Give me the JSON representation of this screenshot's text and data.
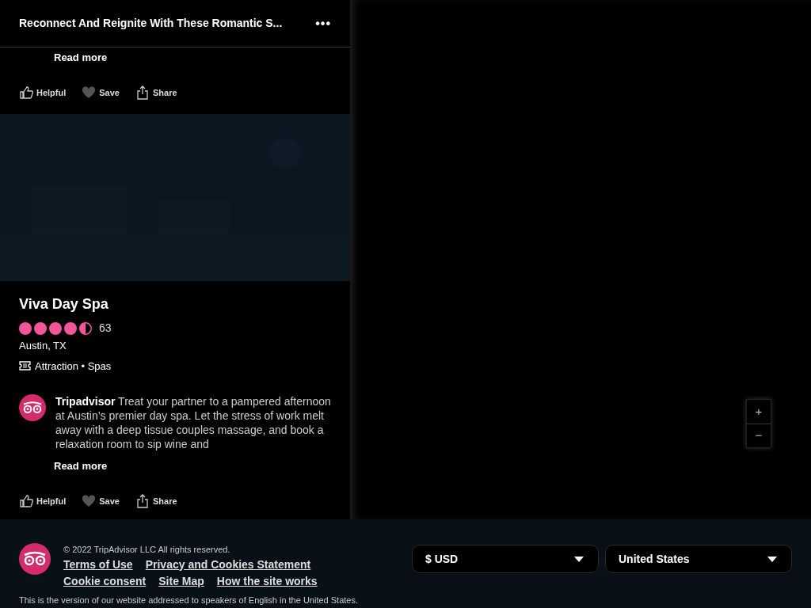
{
  "header": {
    "title": "Reconnect And Reignite With These Romantic S...",
    "menu_icon": "•••"
  },
  "previous_item": {
    "read_more": "Read more",
    "actions": [
      "Helpful",
      "Save",
      "Share"
    ]
  },
  "listing": {
    "kind": "picture",
    "name": "Viva Day Spa",
    "stars": 4.5,
    "review_count": "63",
    "location": "Austin, TX",
    "category": "Attraction • Spas",
    "description": {
      "author": "Tripadvisor",
      "text": "Treat your partner to a pampered afternoon at Austin’s premier day spa. Let the stress of work melt away with a deep tissue couples massage, and book a relaxation room to sip wine and"
    },
    "read_more": "Read more",
    "actions": [
      "Helpful",
      "Save",
      "Share"
    ]
  },
  "map": {
    "zoom_in": "+",
    "zoom_out": "−"
  },
  "footer": {
    "copyright": "© 2022 TripAdvisor LLC All rights reserved.",
    "links": [
      [
        "Terms of Use",
        "Privacy and Cookies Statement"
      ],
      [
        "Cookie consent",
        "Site Map",
        "How the site works"
      ]
    ],
    "note": "This is the version of our website addressed to speakers of English in the United States.",
    "selects": [
      "$ USD",
      "United States"
    ]
  }
}
